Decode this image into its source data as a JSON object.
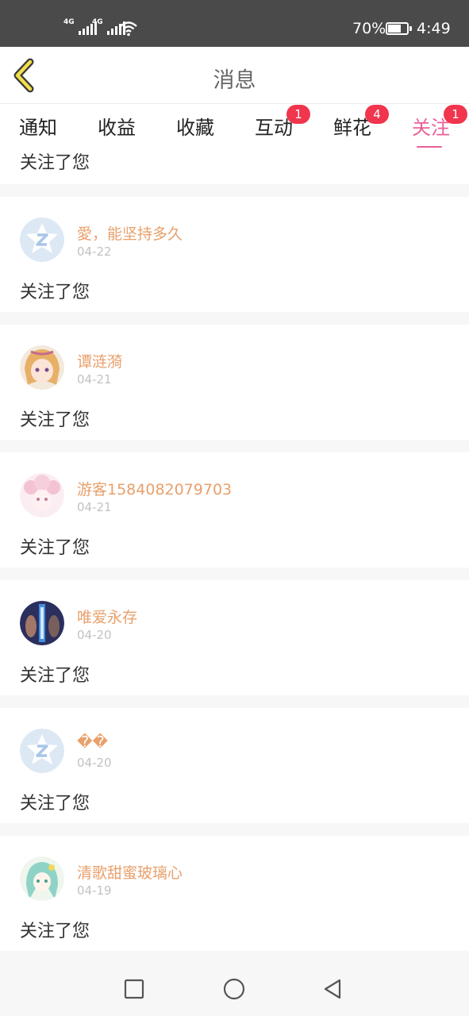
{
  "status_bar": {
    "net1": "4G",
    "net2": "4G",
    "battery_percent": "70%",
    "battery_level": 0.7,
    "time": "4:49"
  },
  "header": {
    "back_icon": "chevron-left-icon",
    "title": "消息"
  },
  "tabs": [
    {
      "label": "通知",
      "badge": ""
    },
    {
      "label": "收益",
      "badge": ""
    },
    {
      "label": "收藏",
      "badge": ""
    },
    {
      "label": "互动",
      "badge": "1"
    },
    {
      "label": "鲜花",
      "badge": "4"
    },
    {
      "label": "关注",
      "badge": "1",
      "active": true
    }
  ],
  "colors": {
    "accent": "#e8609a",
    "badge": "#f0354d",
    "username": "#e8a06c",
    "date": "#c2c2c2",
    "default_avatar": "#dde8f5"
  },
  "partial_item": {
    "action": "关注了您"
  },
  "items": [
    {
      "username": "愛，能坚持多久",
      "date": "04-22",
      "action": "关注了您",
      "avatar": "default-qq-avatar-icon"
    },
    {
      "username": "谭涟漪",
      "date": "04-21",
      "action": "关注了您",
      "avatar": "anime-avatar"
    },
    {
      "username": "游客1584082079703",
      "date": "04-21",
      "action": "关注了您",
      "avatar": "anime-avatar"
    },
    {
      "username": "唯爱永存",
      "date": "04-20",
      "action": "关注了您",
      "avatar": "photo-avatar"
    },
    {
      "username": "��",
      "date": "04-20",
      "action": "关注了您",
      "avatar": "default-qq-avatar-icon"
    },
    {
      "username": "清歌甜蜜玻璃心",
      "date": "04-19",
      "action": "关注了您",
      "avatar": "anime-avatar"
    }
  ],
  "nav_bar": {
    "recent_icon": "square-recent-icon",
    "home_icon": "circle-home-icon",
    "back_icon": "triangle-back-icon"
  }
}
